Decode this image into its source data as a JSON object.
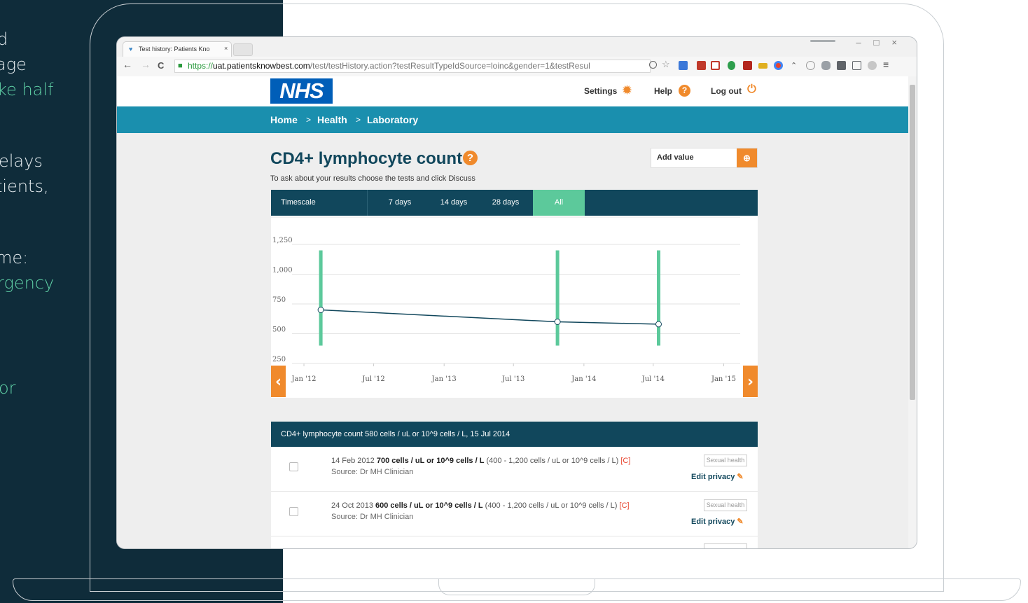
{
  "backdrop": {
    "text_lines": [
      {
        "text": "d",
        "accent": false
      },
      {
        "text": "age",
        "accent": false
      },
      {
        "text": "ke half",
        "accent": true
      },
      {
        "text": "elays",
        "accent": false
      },
      {
        "text": "tients,",
        "accent": false
      },
      {
        "text": "me:",
        "accent": false
      },
      {
        "text": "rgency",
        "accent": true
      },
      {
        "text": "or",
        "accent": true
      }
    ]
  },
  "browser": {
    "tab_title": "Test history: Patients Kno",
    "tab_close": "×",
    "url_https": "https://",
    "url_host": "uat.patientsknowbest.com",
    "url_path": "/test/testHistory.action?testResultTypeIdSource=loinc&gender=1&testResul",
    "window_controls": "–□×",
    "nav": {
      "back": "←",
      "forward": "→",
      "reload": "C"
    },
    "icons": [
      "zoom-icon",
      "star-icon",
      "translate-icon",
      "calendar-icon",
      "bookmark-icon",
      "pin-icon",
      "pdf-icon",
      "extension-icon",
      "chrome-icon",
      "arrow-icon",
      "record-icon",
      "cloud-icon",
      "square-icon",
      "cast-icon",
      "settings-icon",
      "menu-icon"
    ]
  },
  "header": {
    "logo": "NHS",
    "settings": "Settings",
    "help": "Help",
    "help_icon": "?",
    "logout": "Log out"
  },
  "breadcrumb": {
    "sep": ">",
    "items": [
      "Home",
      "Health",
      "Laboratory"
    ]
  },
  "main": {
    "title": "CD4+ lymphocyte count",
    "help_icon": "?",
    "subtitle": "To ask about your results choose the tests and click Discuss",
    "add_value": "Add value"
  },
  "timescale": {
    "label": "Timescale",
    "options": [
      "7 days",
      "14 days",
      "28 days",
      "All"
    ],
    "active": "All"
  },
  "chart_data": {
    "type": "line",
    "y_ticks": [
      "1,250",
      "1,000",
      "750",
      "500",
      "250"
    ],
    "y_tick_values": [
      1250,
      1000,
      750,
      500,
      250
    ],
    "ylim": [
      250,
      1250
    ],
    "x_ticks": [
      "Jan '12",
      "Jul '12",
      "Jan '13",
      "Jul '13",
      "Jan '14",
      "Jul '14",
      "Jan '15"
    ],
    "x_tick_dates": [
      "2012-01-01",
      "2012-07-01",
      "2013-01-01",
      "2013-07-01",
      "2014-01-01",
      "2014-07-01",
      "2015-01-01"
    ],
    "xlim": [
      "2011-10-07",
      "2015-02-13"
    ],
    "points": [
      {
        "date": "2012-02-14",
        "value": 700
      },
      {
        "date": "2013-10-24",
        "value": 600
      },
      {
        "date": "2014-07-15",
        "value": 580
      }
    ],
    "reference_ranges": [
      {
        "date": "2012-02-14",
        "low": 400,
        "high": 1200
      },
      {
        "date": "2013-10-24",
        "low": 400,
        "high": 1200
      },
      {
        "date": "2014-07-15",
        "low": 400,
        "high": 1200
      }
    ],
    "colors": {
      "line": "#11475c",
      "range": "#5cc99b",
      "nav": "#f08a2c"
    },
    "nav_prev": "‹",
    "nav_next": "›"
  },
  "results": {
    "header": "CD4+ lymphocyte count 580 cells / uL or 10^9 cells / L, 15 Jul 2014",
    "rows": [
      {
        "date": "14 Feb 2012",
        "value": "700 cells / uL or 10^9 cells / L",
        "range": "(400 - 1,200 cells / uL or 10^9 cells / L)",
        "flag": "[C]",
        "source": "Source: Dr MH Clinician",
        "tag": "Sexual health",
        "action": "Edit privacy"
      },
      {
        "date": "24 Oct 2013",
        "value": "600 cells / uL or 10^9 cells / L",
        "range": "(400 - 1,200 cells / uL or 10^9 cells / L)",
        "flag": "[C]",
        "source": "Source: Dr MH Clinician",
        "tag": "Sexual health",
        "action": "Edit privacy"
      }
    ]
  },
  "colors": {
    "backdrop": "#0f2c3a",
    "accent_green": "#5fd0a6",
    "nhs_blue": "#005eb8",
    "teal_bar": "#1a8fae",
    "navy": "#11475c",
    "orange": "#f08a2c"
  }
}
